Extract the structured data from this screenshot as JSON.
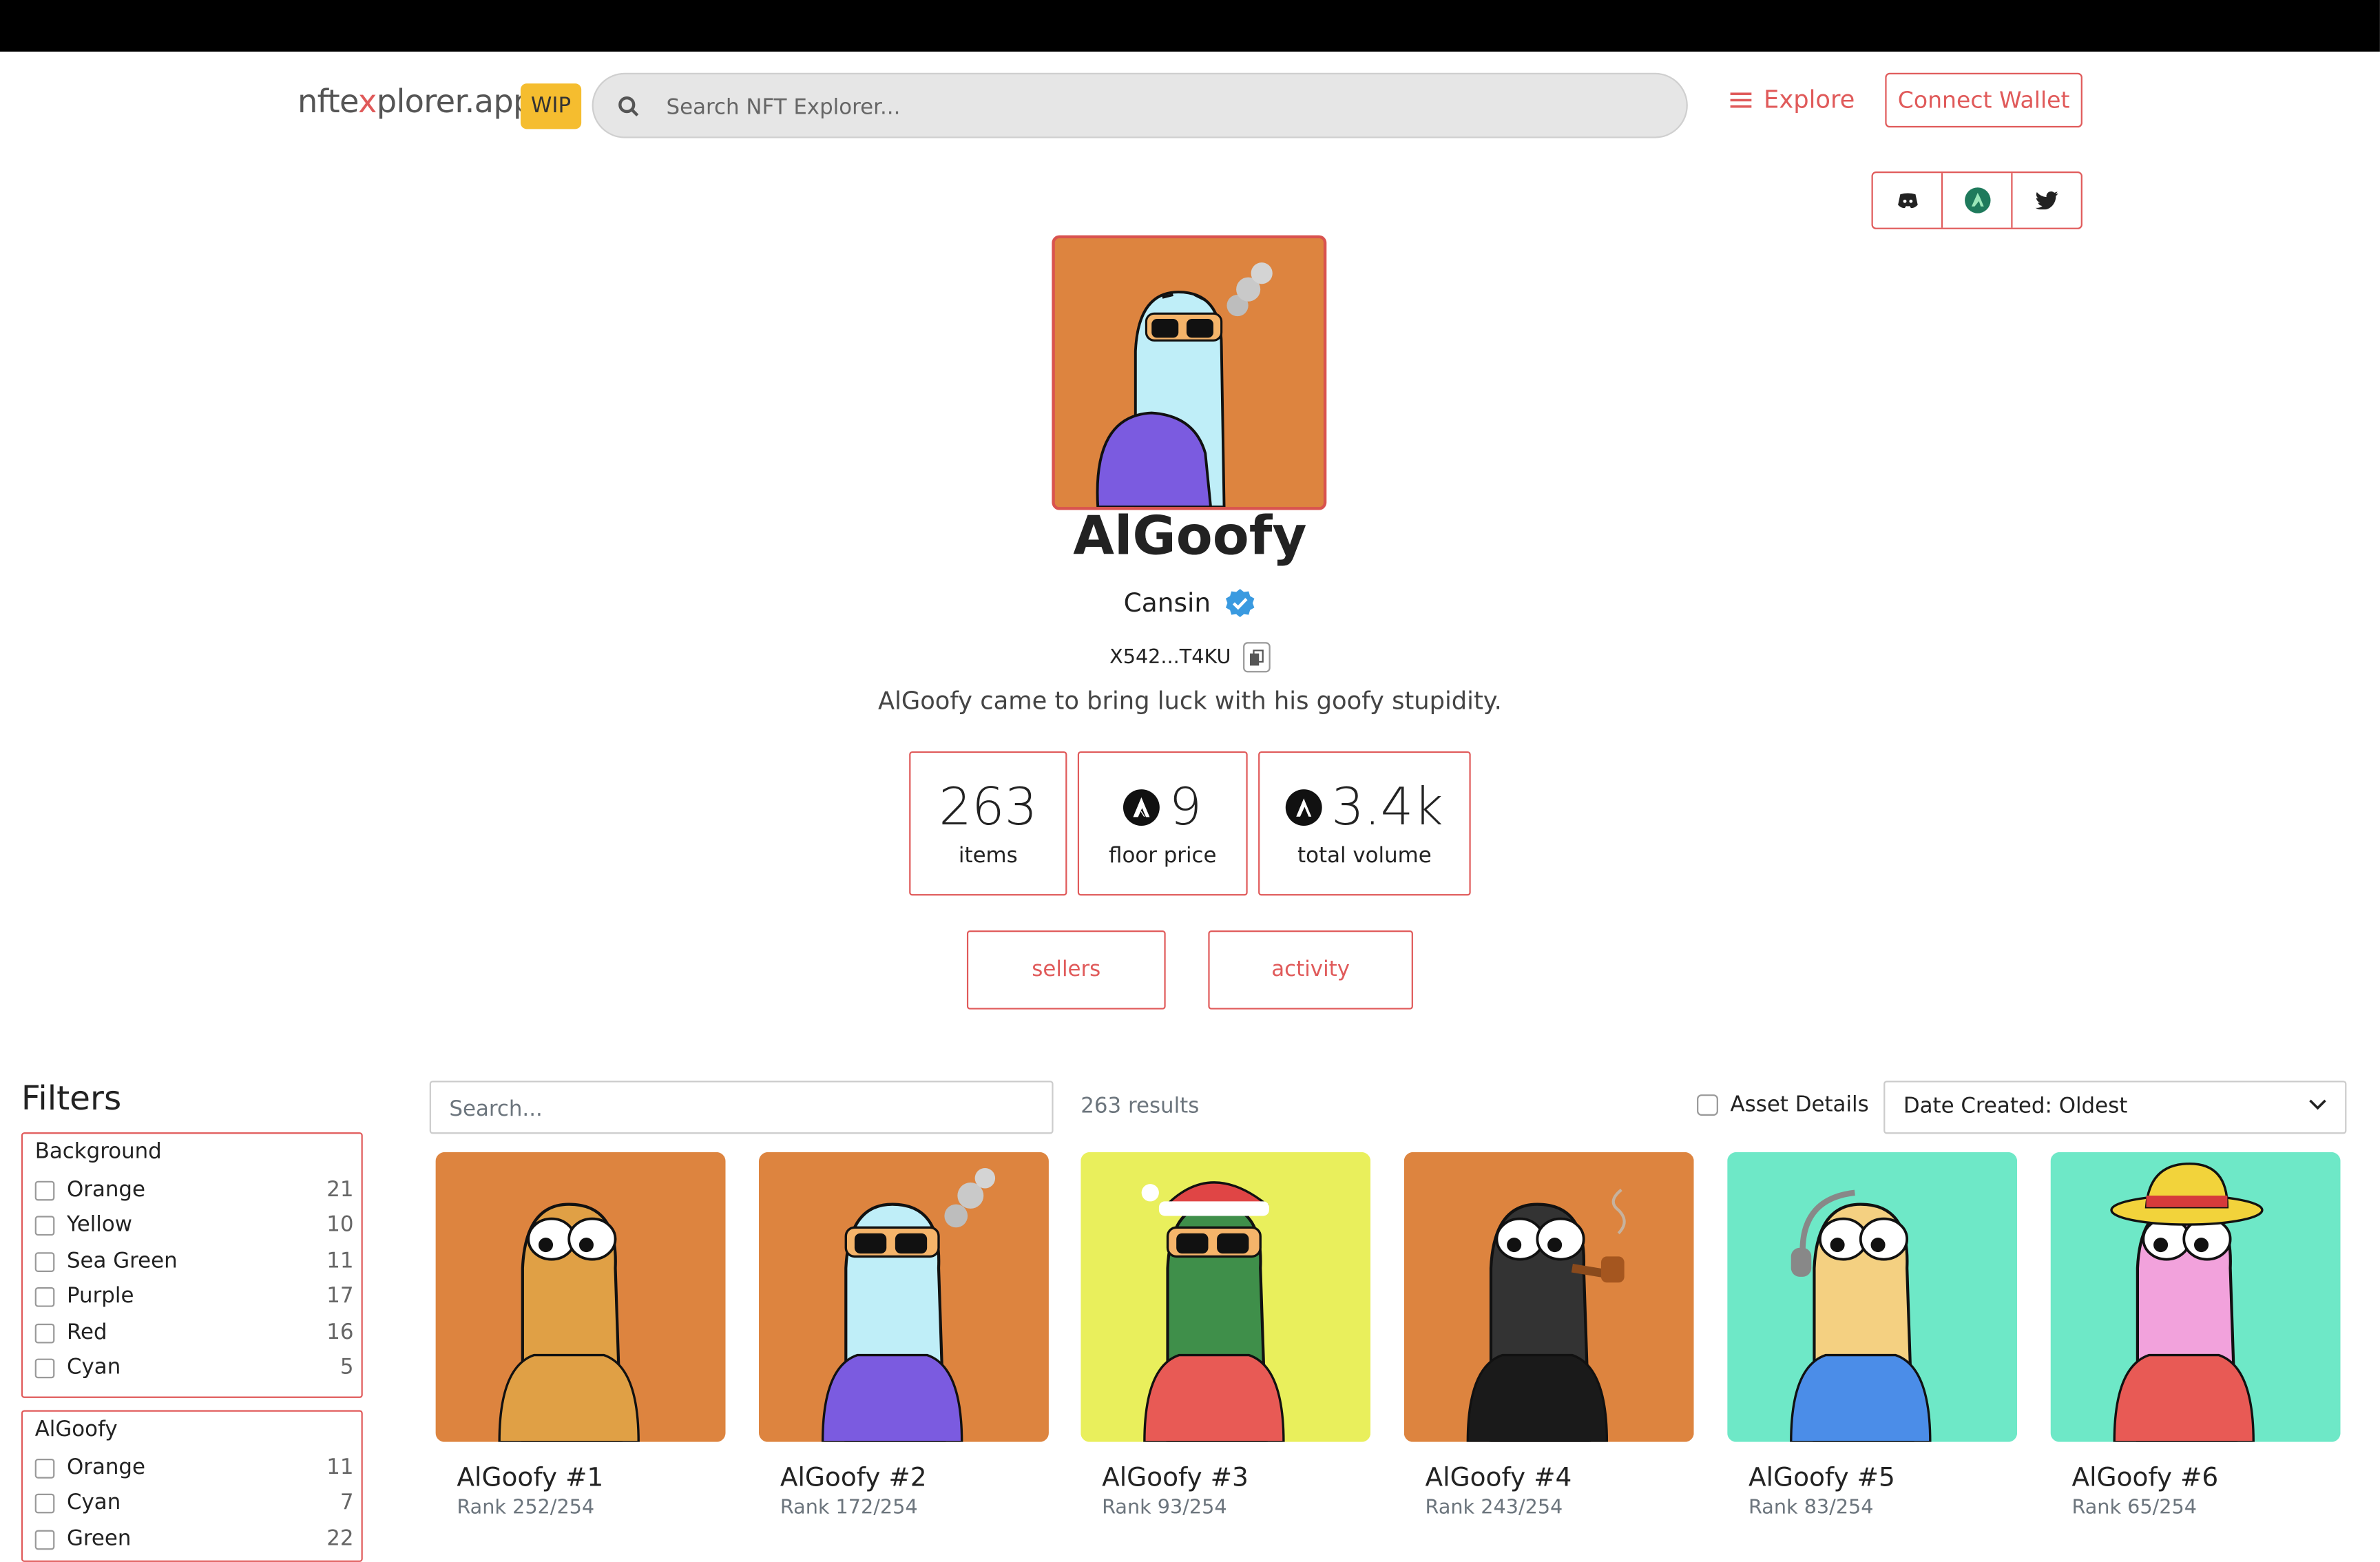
{
  "header": {
    "logo_pre": "nfte",
    "logo_x": "x",
    "logo_post": "plorer.app",
    "wip_badge": "WIP",
    "search_placeholder": "Search NFT Explorer...",
    "explore_label": "Explore",
    "connect_label": "Connect Wallet"
  },
  "social": [
    "discord-icon",
    "algo-leaf-icon",
    "twitter-icon"
  ],
  "collection": {
    "name": "AlGoofy",
    "creator": "Cansin",
    "address": "X542...T4KU",
    "description": "AlGoofy came to bring luck with his goofy stupidity.",
    "image_bg": "#dd843f"
  },
  "stats": [
    {
      "value": "263",
      "label": "items",
      "algo": false
    },
    {
      "value": "9",
      "label": "floor price",
      "algo": true
    },
    {
      "value": "3.4k",
      "label": "total volume",
      "algo": true
    }
  ],
  "tabs": {
    "sellers": "sellers",
    "activity": "activity"
  },
  "filters": {
    "title": "Filters",
    "groups": [
      {
        "title": "Background",
        "options": [
          {
            "label": "Orange",
            "count": "21"
          },
          {
            "label": "Yellow",
            "count": "10"
          },
          {
            "label": "Sea Green",
            "count": "11"
          },
          {
            "label": "Purple",
            "count": "17"
          },
          {
            "label": "Red",
            "count": "16"
          },
          {
            "label": "Cyan",
            "count": "5"
          }
        ]
      },
      {
        "title": "AlGoofy",
        "options": [
          {
            "label": "Orange",
            "count": "11"
          },
          {
            "label": "Cyan",
            "count": "7"
          },
          {
            "label": "Green",
            "count": "22"
          }
        ]
      }
    ]
  },
  "grid": {
    "search_placeholder": "Search...",
    "results": "263 results",
    "asset_details": "Asset Details",
    "sort": "Date Created: Oldest"
  },
  "items": [
    {
      "name": "AlGoofy #1",
      "rank": "Rank 252/254",
      "bg": "#dd843f",
      "body": "#e0a045",
      "shirt": "#e0a045",
      "acc": "none"
    },
    {
      "name": "AlGoofy #2",
      "rank": "Rank 172/254",
      "bg": "#dd843f",
      "body": "#bfeef8",
      "shirt": "#7b5be0",
      "acc": "glasses-smoke"
    },
    {
      "name": "AlGoofy #3",
      "rank": "Rank 93/254",
      "bg": "#e9ef5c",
      "body": "#3f8f4a",
      "shirt": "#e85a55",
      "acc": "santa-glasses"
    },
    {
      "name": "AlGoofy #4",
      "rank": "Rank 243/254",
      "bg": "#dd843f",
      "body": "#333333",
      "shirt": "#1a1a1a",
      "acc": "pipe"
    },
    {
      "name": "AlGoofy #5",
      "rank": "Rank 83/254",
      "bg": "#6ee8c7",
      "body": "#f4d081",
      "shirt": "#4b8de8",
      "acc": "headphones"
    },
    {
      "name": "AlGoofy #6",
      "rank": "Rank 65/254",
      "bg": "#6ee8c7",
      "body": "#f2a2dc",
      "shirt": "#e85a55",
      "acc": "strawhat"
    }
  ]
}
